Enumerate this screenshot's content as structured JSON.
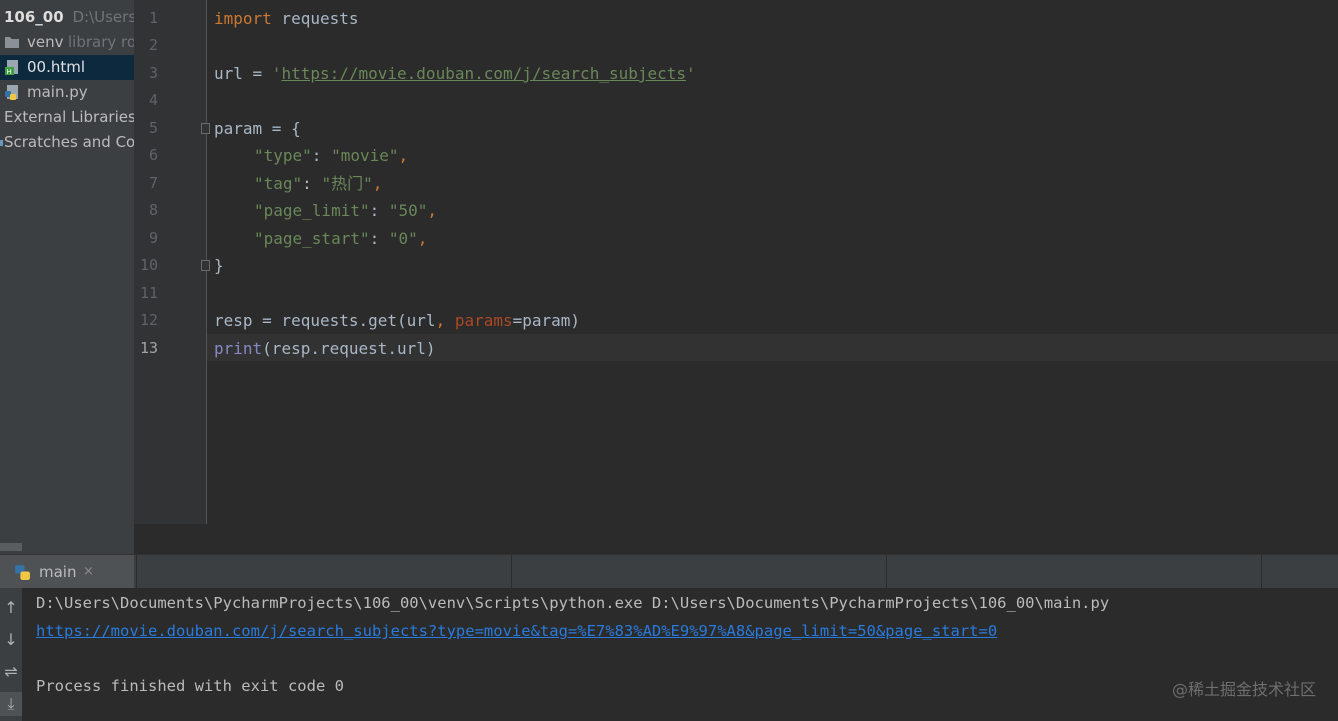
{
  "project": {
    "name": "106_00",
    "path": "D:\\Users\\D",
    "items": [
      {
        "label": "venv",
        "suffix": "library ro",
        "icon": "folder-icon"
      },
      {
        "label": "00.html",
        "icon": "html-file-icon"
      },
      {
        "label": "main.py",
        "icon": "python-file-icon"
      },
      {
        "label": "External Libraries",
        "icon": "library-icon"
      },
      {
        "label": "Scratches and Cor",
        "icon": "scratches-icon"
      }
    ]
  },
  "editor": {
    "line_numbers": [
      "1",
      "2",
      "3",
      "4",
      "5",
      "6",
      "7",
      "8",
      "9",
      "10",
      "11",
      "12",
      "13"
    ],
    "active_line": "13",
    "lines": {
      "l1_kw": "import",
      "l1_rest": " requests",
      "l3_name": "url = ",
      "l3_q1": "'",
      "l3_url": "https://movie.douban.com/j/search_subjects",
      "l3_q2": "'",
      "l5": "param = {",
      "l6_key": "\"type\"",
      "l6_sep": ": ",
      "l6_val": "\"movie\"",
      "l6_comma": ",",
      "l7_key": "\"tag\"",
      "l7_sep": ": ",
      "l7_val": "\"热门\"",
      "l7_comma": ",",
      "l8_key": "\"page_limit\"",
      "l8_sep": ": ",
      "l8_val": "\"50\"",
      "l8_comma": ",",
      "l9_key": "\"page_start\"",
      "l9_sep": ": ",
      "l9_val": "\"0\"",
      "l9_comma": ",",
      "l10": "}",
      "l12_a": "resp = requests.get(url",
      "l12_comma": ", ",
      "l12_param": "params",
      "l12_b": "=param)",
      "l13_fn": "print",
      "l13_rest": "(resp.request.url)"
    }
  },
  "run": {
    "tab_label": "main",
    "tab_close": "×",
    "command": "D:\\Users\\Documents\\PycharmProjects\\106_00\\venv\\Scripts\\python.exe D:\\Users\\Documents\\PycharmProjects\\106_00\\main.py",
    "output_url": "https://movie.douban.com/j/search_subjects?type=movie&tag=%E7%83%AD%E9%97%A8&page_limit=50&page_start=0",
    "exit_message": "Process finished with exit code 0",
    "toolbar": [
      {
        "icon": "arrow-up-icon",
        "glyph": "↑"
      },
      {
        "icon": "arrow-down-icon",
        "glyph": "↓"
      },
      {
        "icon": "soft-wrap-icon",
        "glyph": "⇌"
      },
      {
        "icon": "scroll-to-end-icon",
        "glyph": "⤓"
      }
    ]
  },
  "watermark": "@稀土掘金技术社区",
  "colors": {
    "keyword": "#cc7832",
    "string": "#6a8759",
    "link": "#287bde",
    "builtin": "#8888c6",
    "param": "#aa4926",
    "selection": "#0d293e",
    "accent": "#4a88c7"
  }
}
